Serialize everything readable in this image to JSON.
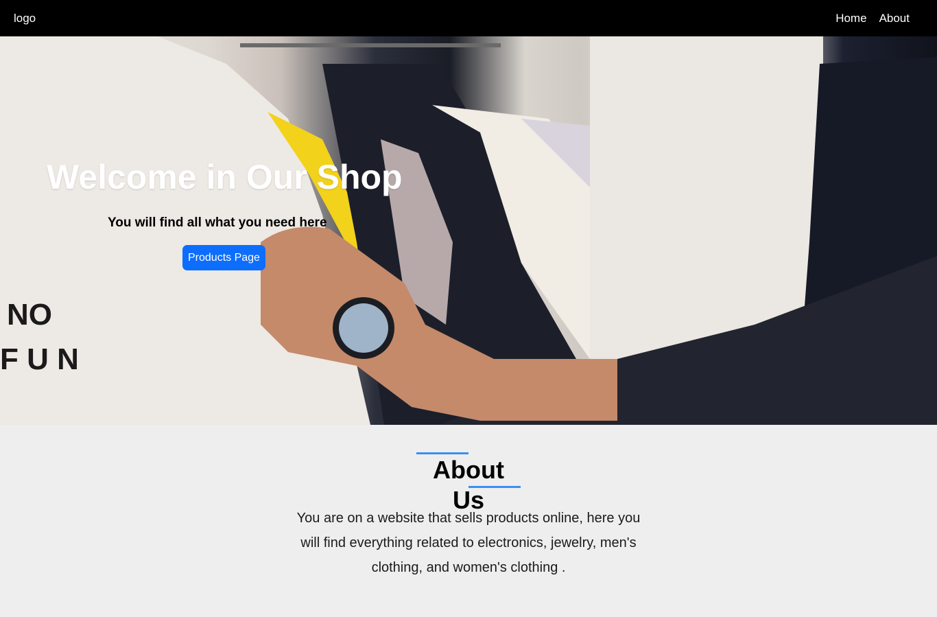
{
  "navbar": {
    "logo": "logo",
    "links": [
      {
        "label": "Home"
      },
      {
        "label": "About"
      }
    ]
  },
  "hero": {
    "title": "Welcome in Our Shop",
    "subtitle": "You will find all what you need here",
    "cta_label": "Products Page",
    "image": "clothing-rack-photo",
    "shirt_print": "NO FUN"
  },
  "about": {
    "title": "About Us",
    "text": "You are on a website that sells products online, here you will find everything related to electronics, jewelry, men's clothing, and women's clothing ."
  },
  "colors": {
    "navbar_bg": "#000000",
    "accent": "#0d6efd",
    "about_bar": "#3b8ff0",
    "about_bg": "#eeeeee"
  }
}
